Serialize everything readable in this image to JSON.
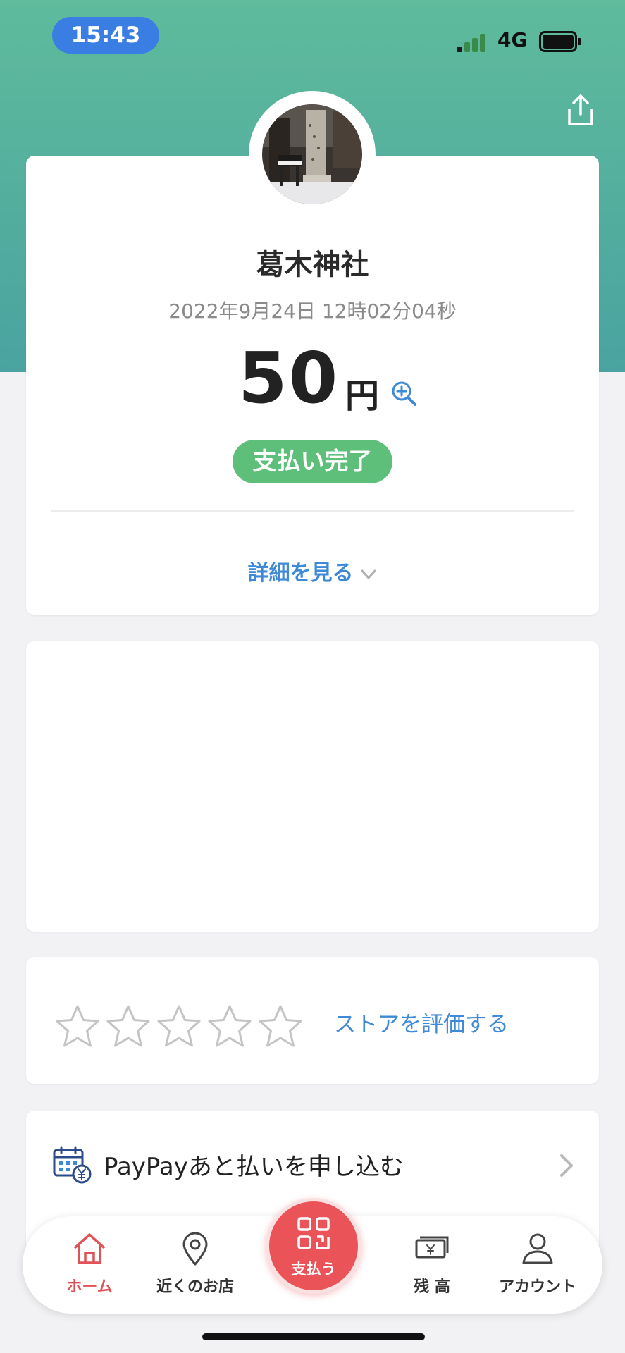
{
  "status_bar": {
    "time": "15:43",
    "network": "4G"
  },
  "header": {
    "share_icon": "share-icon"
  },
  "receipt": {
    "store_name": "葛木神社",
    "datetime": "2022年9月24日 12時02分04秒",
    "amount": "50",
    "currency": "円",
    "status": "支払い完了",
    "details_link": "詳細を見る"
  },
  "rating": {
    "star_count": 5,
    "filled": 0,
    "link": "ストアを評価する"
  },
  "paypay_later": {
    "label": "PayPayあと払いを申し込む"
  },
  "tabbar": {
    "home": "ホーム",
    "nearby": "近くのお店",
    "pay": "支払う",
    "balance": "残 高",
    "account": "アカウント"
  },
  "colors": {
    "header_gradient_top": "#5fbb9c",
    "header_gradient_bottom": "#4aa3a0",
    "badge_green": "#5ebf7b",
    "link_blue": "#3f8ad6",
    "pay_red": "#ea5459",
    "home_active": "#e05256"
  }
}
